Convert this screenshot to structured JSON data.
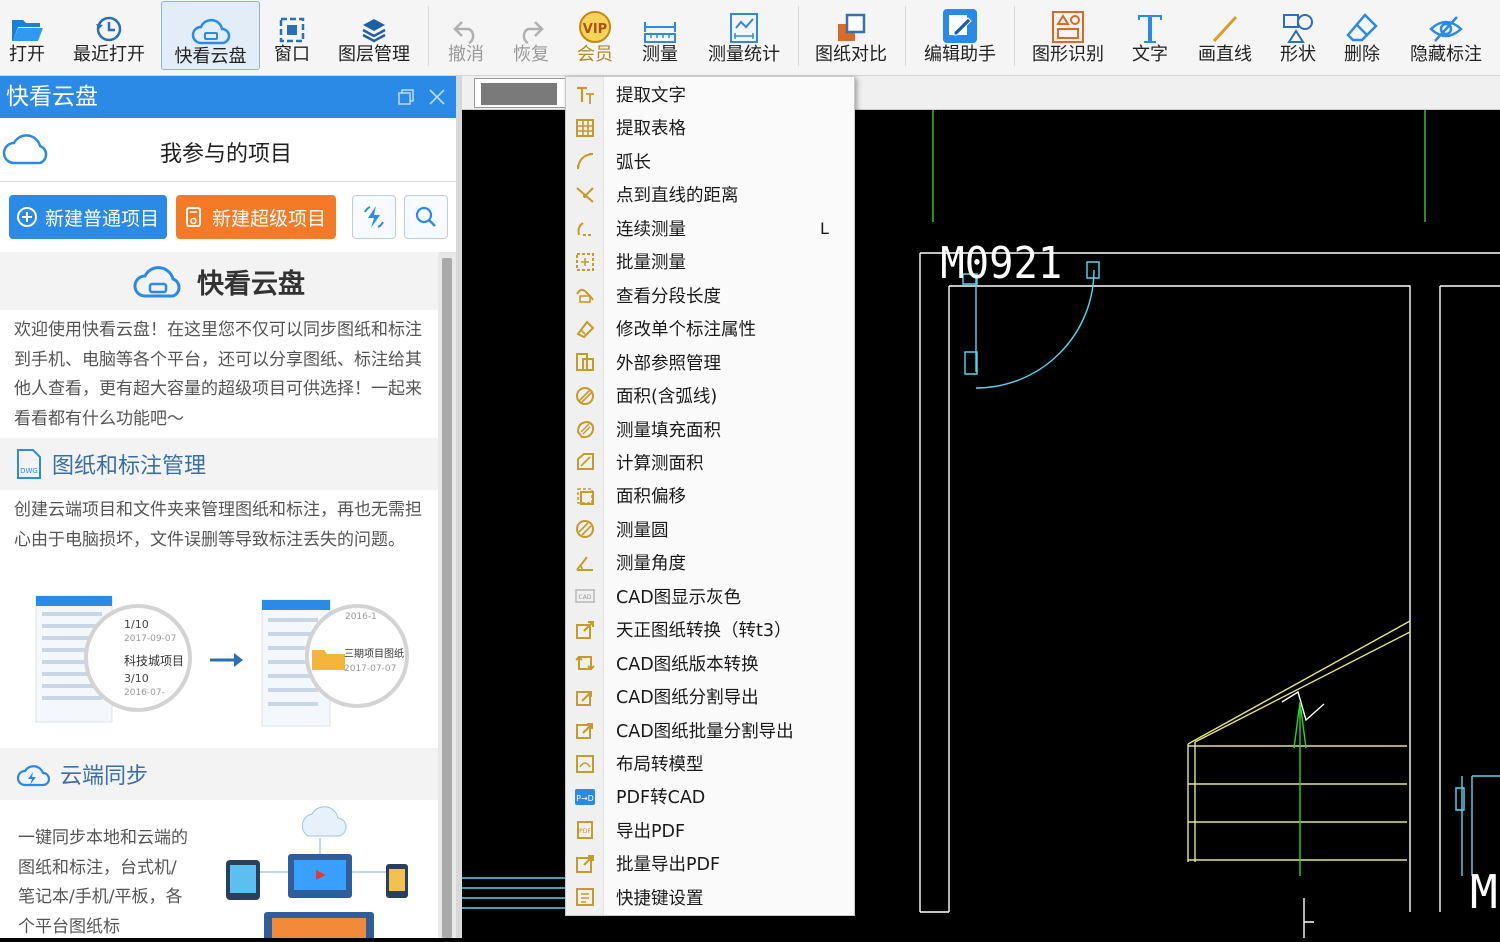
{
  "toolbar": {
    "buttons": [
      {
        "label": "打开",
        "icon": "folder-open-icon"
      },
      {
        "label": "最近打开",
        "icon": "history-icon"
      },
      {
        "label": "快看云盘",
        "icon": "cloud-drive-icon",
        "active": true
      },
      {
        "label": "窗口",
        "icon": "window-icon"
      },
      {
        "label": "图层管理",
        "icon": "layers-icon"
      },
      {
        "label": "撤消",
        "icon": "undo-icon",
        "disabled": true
      },
      {
        "label": "恢复",
        "icon": "redo-icon",
        "disabled": true
      },
      {
        "label": "会员",
        "icon": "vip-icon"
      },
      {
        "label": "测量",
        "icon": "measure-icon"
      },
      {
        "label": "测量统计",
        "icon": "measure-stats-icon"
      },
      {
        "label": "图纸对比",
        "icon": "compare-icon"
      },
      {
        "label": "编辑助手",
        "icon": "edit-assistant-icon"
      },
      {
        "label": "图形识别",
        "icon": "shape-recognize-icon"
      },
      {
        "label": "文字",
        "icon": "text-icon"
      },
      {
        "label": "画直线",
        "icon": "line-icon"
      },
      {
        "label": "形状",
        "icon": "shape-icon"
      },
      {
        "label": "删除",
        "icon": "eraser-icon"
      },
      {
        "label": "隐藏标注",
        "icon": "hide-annotation-icon"
      }
    ]
  },
  "panel": {
    "title": "快看云盘",
    "project_heading": "我参与的项目",
    "new_normal_label": "新建普通项目",
    "new_super_label": "新建超级项目",
    "brand": "快看云盘",
    "intro": "欢迎使用快看云盘！在这里您不仅可以同步图纸和标注到手机、电脑等各个平台，还可以分享图纸、标注给其他人查看，更有超大容量的超级项目可供选择！一起来看看都有什么功能吧～",
    "section1_title": "图纸和标注管理",
    "section1_text": "创建云端项目和文件夹来管理图纸和标注，再也无需担心由于电脑损坏，文件误删等导致标注丢失的问题。",
    "illus": {
      "lens1_a": "1/10",
      "lens1_b": "2017-09-07",
      "lens1_c": "科技城项目",
      "lens1_d": "3/10",
      "lens1_e": "2016-07-",
      "lens2_a": "2016-1",
      "lens2_b": "三期项目图纸",
      "lens2_c": "2017-07-07"
    },
    "section2_title": "云端同步",
    "section2_text": "一键同步本地和云端的图纸和标注，台式机/笔记本/手机/平板，各个平台图纸标"
  },
  "canvas": {
    "door_label": "M0921",
    "edge_label": "M"
  },
  "menu": {
    "items": [
      {
        "label": "提取文字",
        "icon": "extract-text-icon"
      },
      {
        "label": "提取表格",
        "icon": "extract-table-icon"
      },
      {
        "label": "弧长",
        "icon": "arc-length-icon"
      },
      {
        "label": "点到直线的距离",
        "icon": "point-line-distance-icon"
      },
      {
        "label": "连续测量",
        "icon": "continuous-measure-icon",
        "shortcut": "L"
      },
      {
        "label": "批量测量",
        "icon": "batch-measure-icon"
      },
      {
        "label": "查看分段长度",
        "icon": "segment-length-icon"
      },
      {
        "label": "修改单个标注属性",
        "icon": "edit-annotation-icon"
      },
      {
        "label": "外部参照管理",
        "icon": "xref-icon"
      },
      {
        "label": "面积(含弧线)",
        "icon": "area-arc-icon"
      },
      {
        "label": "测量填充面积",
        "icon": "fill-area-icon"
      },
      {
        "label": "计算测面积",
        "icon": "calc-area-icon"
      },
      {
        "label": "面积偏移",
        "icon": "area-offset-icon"
      },
      {
        "label": "测量圆",
        "icon": "measure-circle-icon"
      },
      {
        "label": "测量角度",
        "icon": "measure-angle-icon"
      },
      {
        "label": "CAD图显示灰色",
        "icon": "cad-gray-icon"
      },
      {
        "label": "天正图纸转换（转t3）",
        "icon": "tangent-convert-icon"
      },
      {
        "label": "CAD图纸版本转换",
        "icon": "version-convert-icon"
      },
      {
        "label": "CAD图纸分割导出",
        "icon": "split-export-icon"
      },
      {
        "label": "CAD图纸批量分割导出",
        "icon": "batch-split-export-icon"
      },
      {
        "label": "布局转模型",
        "icon": "layout-model-icon"
      },
      {
        "label": "PDF转CAD",
        "icon": "pdf-to-cad-icon"
      },
      {
        "label": "导出PDF",
        "icon": "export-pdf-icon"
      },
      {
        "label": "批量导出PDF",
        "icon": "batch-export-pdf-icon"
      },
      {
        "label": "快捷键设置",
        "icon": "shortcut-settings-icon"
      }
    ]
  },
  "colors": {
    "accent": "#2a8ae6",
    "orange": "#f57a28",
    "cad_white": "#ffffff",
    "cad_cyan": "#55d8ee",
    "cad_yellow": "#e6e67a",
    "cad_green": "#2fd12f",
    "menu_icon": "#c59b2a"
  }
}
